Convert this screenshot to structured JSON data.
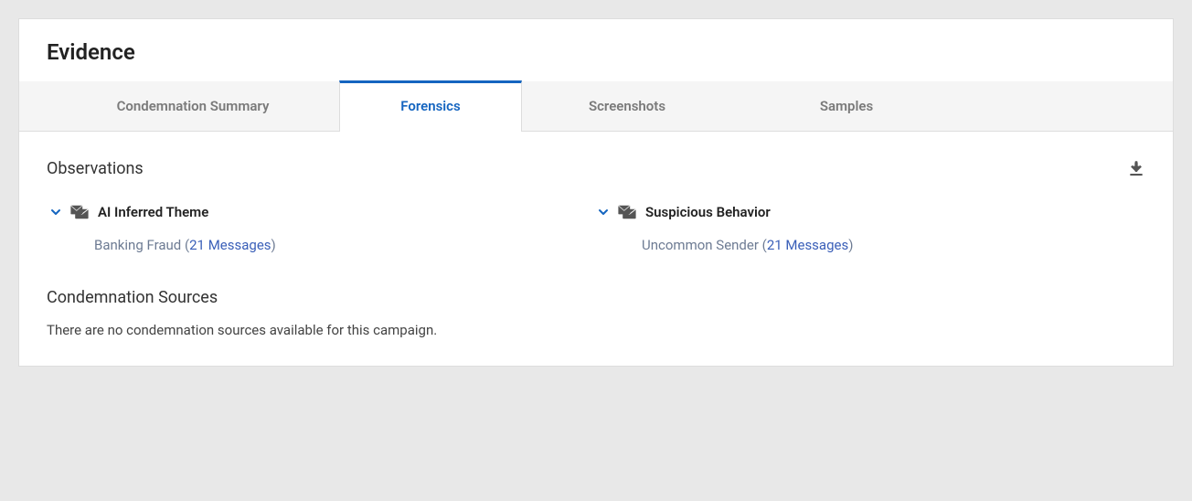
{
  "header": {
    "title": "Evidence"
  },
  "tabs": [
    {
      "label": "Condemnation Summary",
      "active": false
    },
    {
      "label": "Forensics",
      "active": true
    },
    {
      "label": "Screenshots",
      "active": false
    },
    {
      "label": "Samples",
      "active": false
    }
  ],
  "observations": {
    "title": "Observations",
    "groups": [
      {
        "title": "AI Inferred Theme",
        "items": [
          {
            "label": "Banking Fraud",
            "count_text": "21 Messages"
          }
        ]
      },
      {
        "title": "Suspicious Behavior",
        "items": [
          {
            "label": "Uncommon Sender",
            "count_text": "21 Messages"
          }
        ]
      }
    ]
  },
  "condemnation_sources": {
    "title": "Condemnation Sources",
    "empty_text": "There are no condemnation sources available for this campaign."
  }
}
